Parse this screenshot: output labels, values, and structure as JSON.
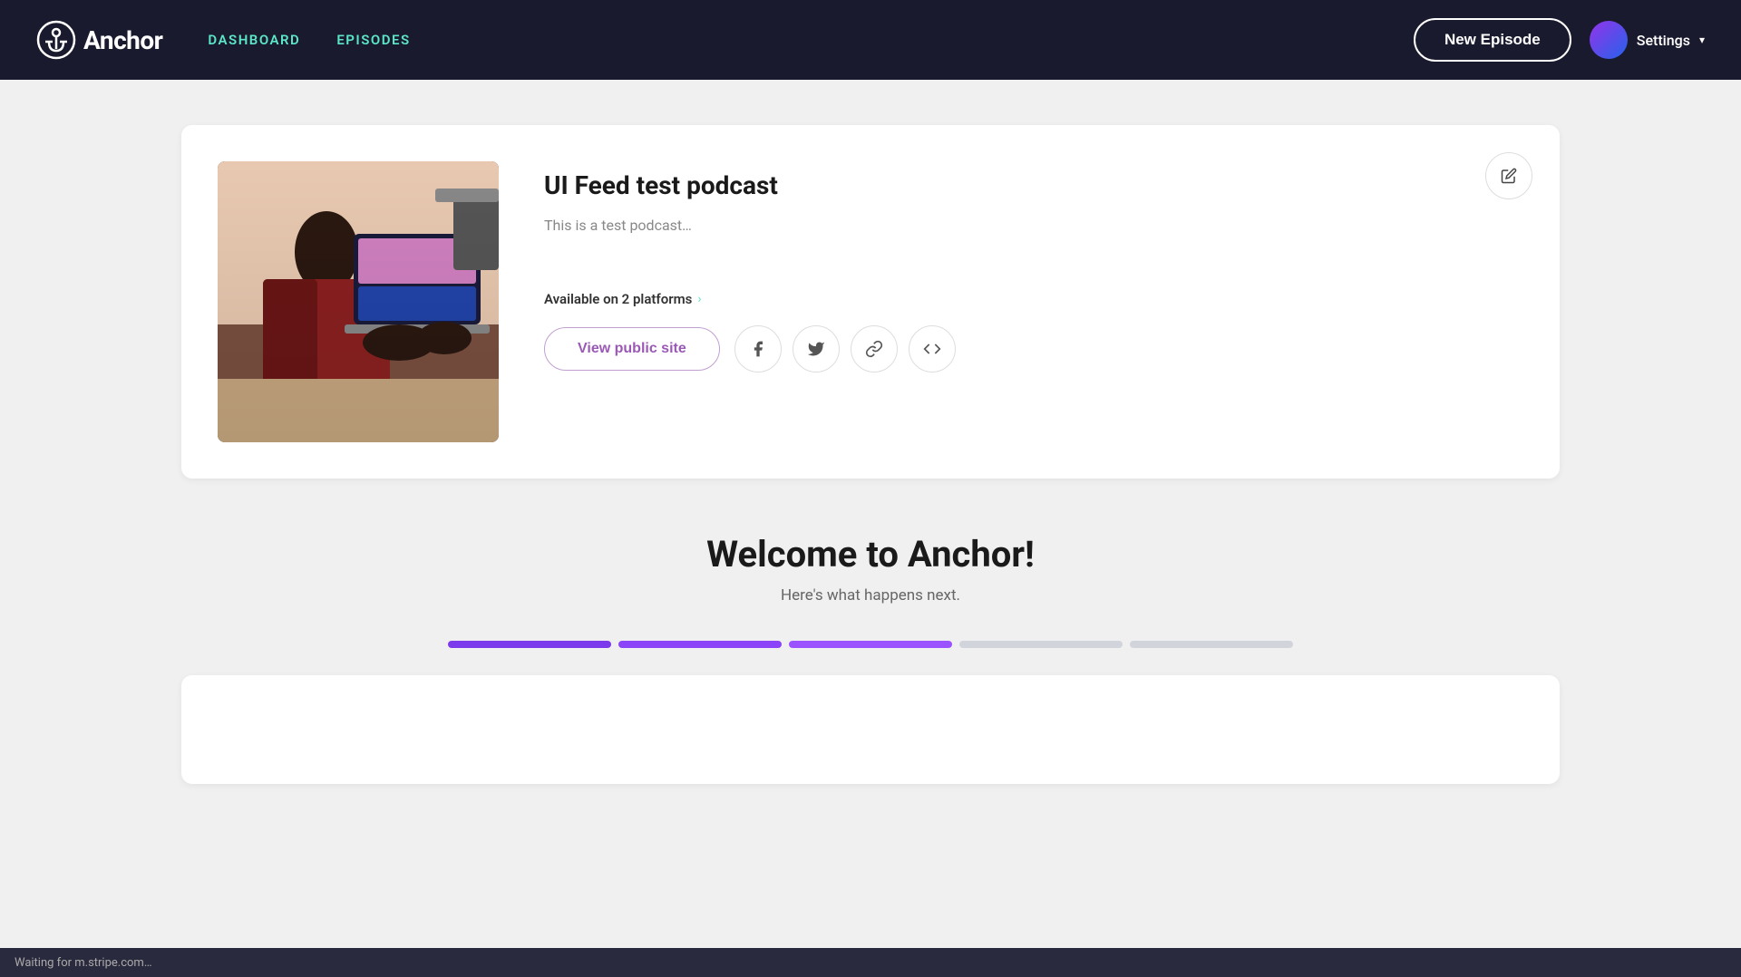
{
  "navbar": {
    "logo_text": "Anchor",
    "nav_links": [
      {
        "label": "DASHBOARD",
        "id": "dashboard"
      },
      {
        "label": "EPISODES",
        "id": "episodes"
      }
    ],
    "new_episode_label": "New Episode",
    "settings_label": "Settings"
  },
  "podcast_card": {
    "title": "UI Feed test podcast",
    "description": "This is a test podcast…",
    "platforms_text": "Available on 2 platforms",
    "view_public_label": "View public site",
    "edit_icon": "✏",
    "social_buttons": [
      {
        "id": "facebook",
        "icon": "f",
        "label": "Facebook"
      },
      {
        "id": "twitter",
        "icon": "t",
        "label": "Twitter"
      },
      {
        "id": "link",
        "icon": "🔗",
        "label": "Copy Link"
      },
      {
        "id": "embed",
        "icon": "</>",
        "label": "Embed"
      }
    ]
  },
  "welcome_section": {
    "title": "Welcome to Anchor!",
    "subtitle": "Here's what happens next."
  },
  "progress_steps": [
    {
      "id": "step-1",
      "state": "active-1"
    },
    {
      "id": "step-2",
      "state": "active-2"
    },
    {
      "id": "step-3",
      "state": "active-3"
    },
    {
      "id": "step-4",
      "state": "inactive"
    },
    {
      "id": "step-5",
      "state": "inactive"
    }
  ],
  "status_bar": {
    "text": "Waiting for m.stripe.com…"
  }
}
